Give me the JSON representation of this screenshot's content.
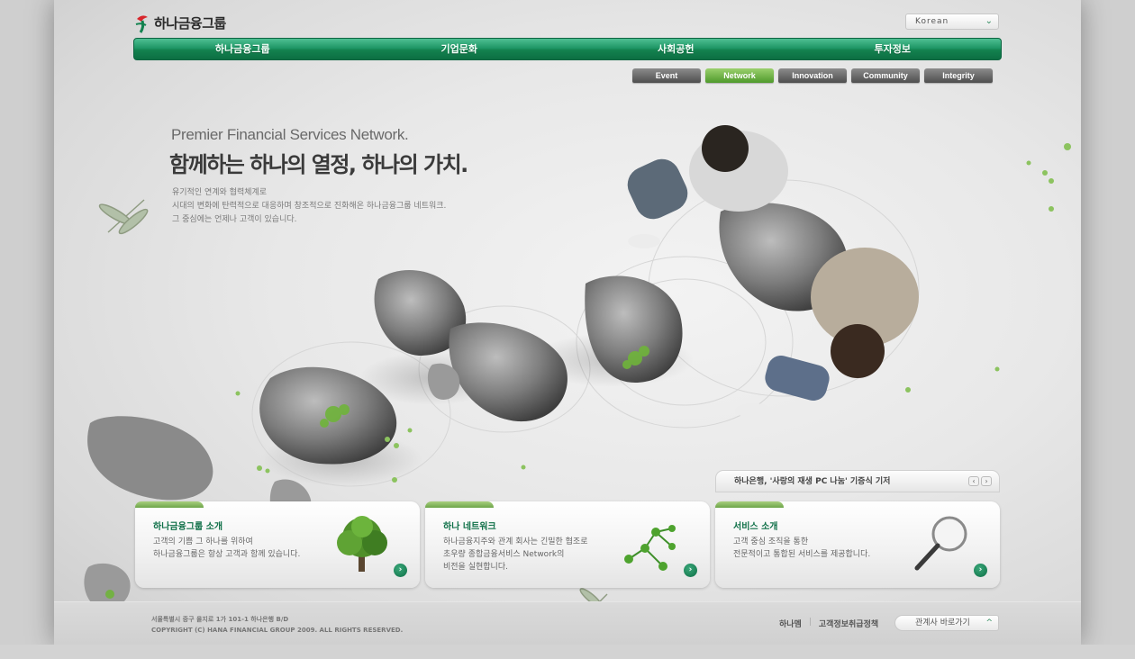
{
  "header": {
    "logo_text": "하나금융그룹",
    "language_selected": "Korean"
  },
  "nav": {
    "items": [
      "하나금융그룹",
      "기업문화",
      "사회공헌",
      "투자정보"
    ]
  },
  "subtabs": {
    "items": [
      "Event",
      "Network",
      "Innovation",
      "Community",
      "Integrity"
    ],
    "active": "Network"
  },
  "hero": {
    "subtitle": "Premier Financial Services Network.",
    "title": "함께하는 하나의 열정, 하나의 가치.",
    "body_line1": "유기적인 연계와 협력체계로",
    "body_line2": "시대의 변화에 탄력적으로 대응하며 창조적으로 진화해온 하나금융그룹 네트워크.",
    "body_line3": "그 중심에는 언제나 고객이 있습니다."
  },
  "ticker": {
    "text": "하나은행, '사랑의 재생 PC 나눔' 기증식 기저",
    "prev": "‹",
    "next": "›"
  },
  "cards": [
    {
      "title": "하나금융그룹 소개",
      "line1": "고객의 기쁨 그 하나를 위하여",
      "line2": "하나금융그룹은 항상 고객과 함께 있습니다.",
      "line3": "",
      "icon": "tree-icon"
    },
    {
      "title": "하나 네트워크",
      "line1": "하나금융지주와 관계 회사는 긴밀한 협조로",
      "line2": "초우량 종합금융서비스 Network의",
      "line3": "비전을 실현합니다.",
      "icon": "network-molecule-icon"
    },
    {
      "title": "서비스 소개",
      "line1": "고객 중심 조직을 통한",
      "line2": "전문적이고 통합된 서비스를 제공합니다.",
      "line3": "",
      "icon": "magnifier-icon"
    }
  ],
  "footer": {
    "address": "서울특별시 중구 을지로 1가 101-1 하나은행 B/D",
    "copyright": "COPYRIGHT (C) HANA FINANCIAL GROUP 2009. ALL RIGHTS RESERVED.",
    "link1": "하나멤",
    "link2": "고객정보취급정책",
    "shortcut": "관계사 바로가기"
  },
  "colors": {
    "brand_green": "#13824f",
    "accent_lightgreen": "#8cc35f",
    "frame_bg": "#ebebeb"
  }
}
